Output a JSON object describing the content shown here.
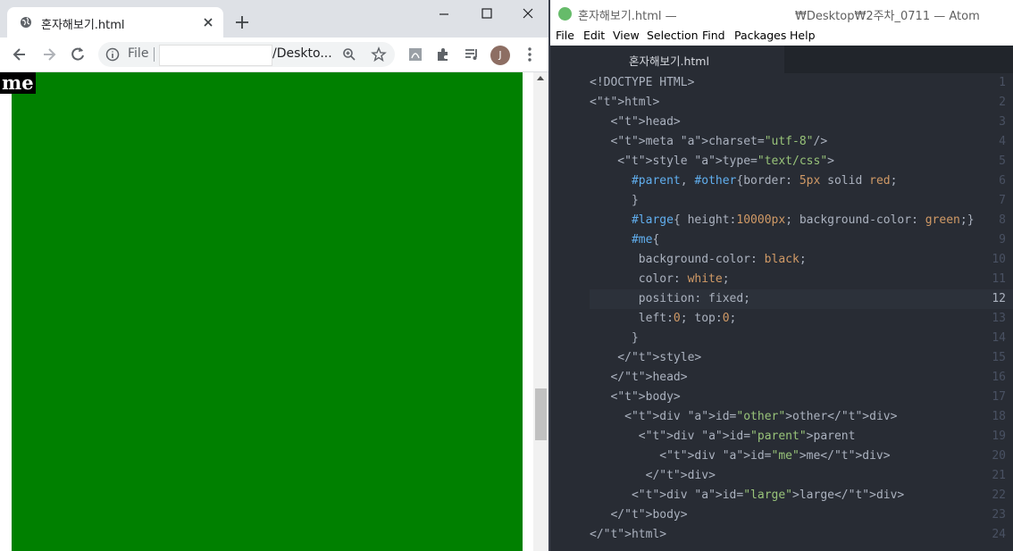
{
  "chrome": {
    "tab_title": "혼자해보기.html",
    "url_scheme": "File",
    "url_path": "/Deskto...",
    "avatar_initial": "J",
    "page": {
      "me_text": "me",
      "large_bg": "#008000"
    }
  },
  "atom": {
    "title_left": "혼자해보기.html —",
    "title_right": "₩Desktop₩2주차_0711 — Atom",
    "menu": [
      "File",
      "Edit",
      "View",
      "Selection",
      "Find",
      "Packages",
      "Help"
    ],
    "tab_label": "혼자해보기.html",
    "active_line": 12,
    "code_lines": [
      "<!DOCTYPE HTML>",
      "<html>",
      "   <head>",
      "   <meta charset=\"utf-8\"/>",
      "    <style type=\"text/css\">",
      "      #parent, #other{border: 5px solid red;",
      "      }",
      "      #large{ height:10000px; background-color: green;}",
      "      #me{",
      "       background-color: black;",
      "       color: white;",
      "       position: fixed;",
      "       left:0; top:0;",
      "      }",
      "    </style>",
      "   </head>",
      "   <body>",
      "     <div id=\"other\">other</div>",
      "       <div id=\"parent\">parent",
      "          <div id=\"me\">me</div>",
      "        </div>",
      "      <div id=\"large\">large</div>",
      "   </body>",
      "</html>"
    ]
  }
}
